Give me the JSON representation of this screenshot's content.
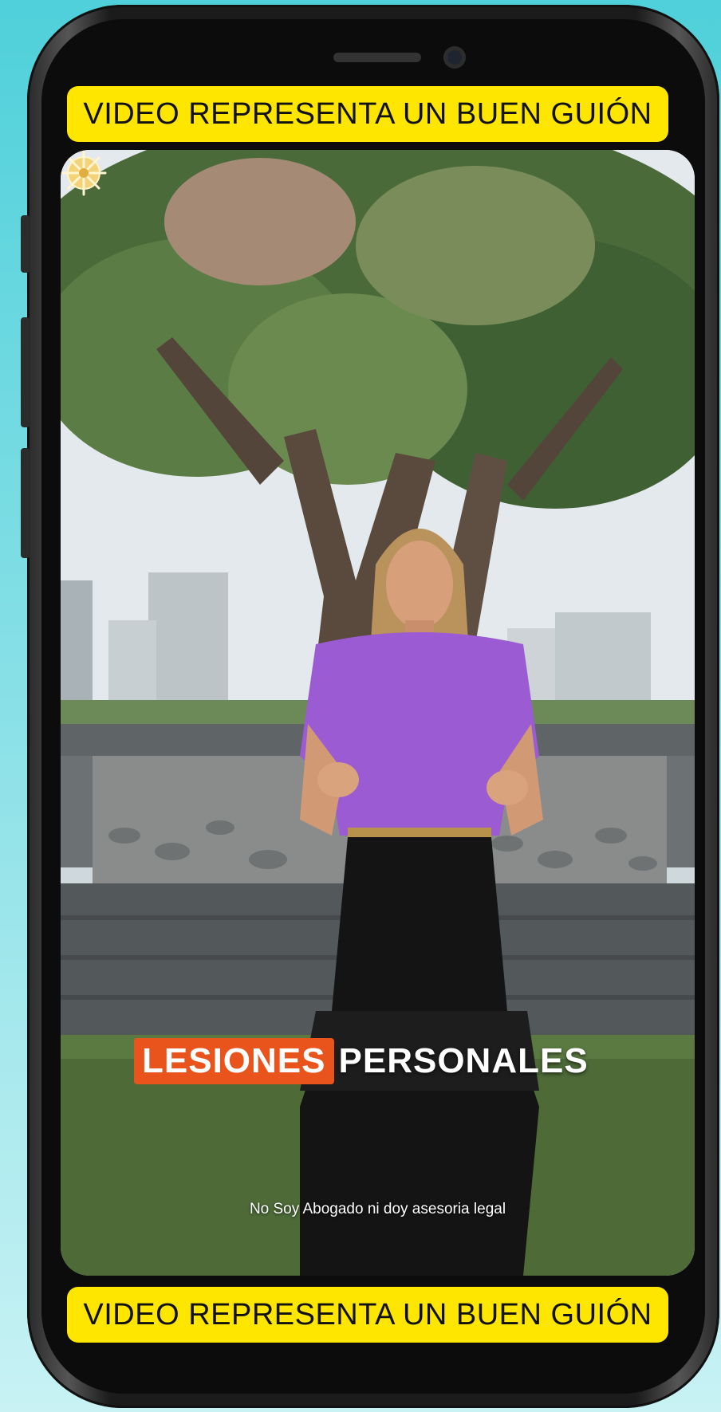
{
  "banner_top": {
    "text": "VIDEO REPRESENTA UN BUEN GUIÓN"
  },
  "banner_bottom": {
    "text": "VIDEO REPRESENTA UN BUEN GUIÓN"
  },
  "video": {
    "title_highlight": "LESIONES",
    "title_rest": "PERSONALES",
    "disclaimer": "No Soy Abogado ni doy asesoria legal",
    "logo_icon": "starburst-logo-icon"
  },
  "colors": {
    "banner_bg": "#ffe600",
    "title_highlight_bg": "#e8541c",
    "shirt": "#9b5bd2",
    "background": "#4fd0da"
  }
}
